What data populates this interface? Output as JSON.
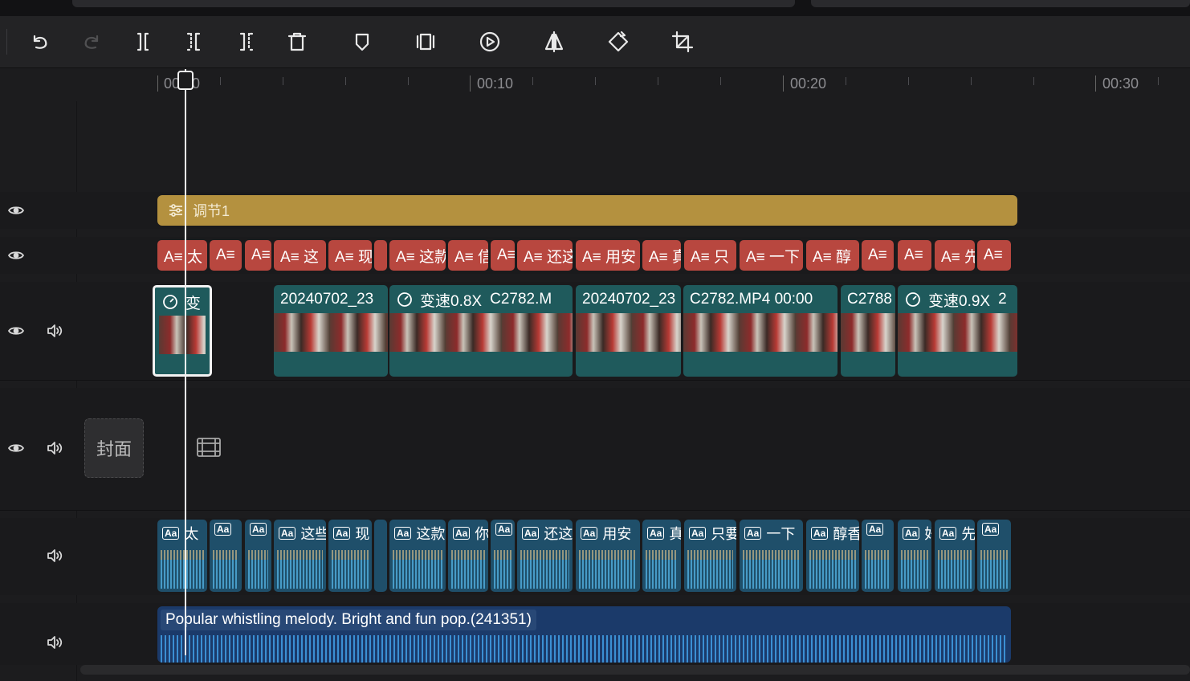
{
  "toolbar": {
    "buttons": [
      "undo",
      "redo",
      "split",
      "split-left",
      "split-right",
      "delete",
      "mark",
      "freeze",
      "play-segment",
      "mirror",
      "rotate",
      "crop"
    ]
  },
  "ruler": {
    "labels": [
      "00:00",
      "00:10",
      "00:20",
      "00:30"
    ]
  },
  "tracks": {
    "adjustment": {
      "label": "调节1",
      "color": "#b4913f"
    },
    "text_clips": [
      {
        "label": "A≡ 太"
      },
      {
        "label": "A≡"
      },
      {
        "label": "A≡"
      },
      {
        "label": "A≡ 这"
      },
      {
        "label": "A≡ 现"
      },
      {
        "label": ""
      },
      {
        "label": "A≡ 这款"
      },
      {
        "label": "A≡ 信"
      },
      {
        "label": "A≡"
      },
      {
        "label": "A≡ 还这"
      },
      {
        "label": "A≡ 用安"
      },
      {
        "label": "A≡ 真"
      },
      {
        "label": "A≡ 只"
      },
      {
        "label": "A≡ 一下"
      },
      {
        "label": "A≡ 醇"
      },
      {
        "label": "A≡"
      },
      {
        "label": "A≡"
      },
      {
        "label": "A≡ 先"
      },
      {
        "label": "A≡"
      }
    ],
    "video_clips": [
      {
        "speed": "变",
        "name": ""
      },
      {
        "speed": "",
        "name": "20240702_23"
      },
      {
        "speed": "变速0.8X",
        "name": "C2782.M"
      },
      {
        "speed": "",
        "name": "20240702_23"
      },
      {
        "speed": "",
        "name": "C2782.MP4 00:00"
      },
      {
        "speed": "",
        "name": "C2788"
      },
      {
        "speed": "变速0.9X",
        "name": "2"
      }
    ],
    "cover": {
      "label": "封面"
    },
    "voice_clips": [
      {
        "label": "太"
      },
      {
        "label": ""
      },
      {
        "label": ""
      },
      {
        "label": "这些"
      },
      {
        "label": "现"
      },
      {
        "label": ""
      },
      {
        "label": "这款"
      },
      {
        "label": "你"
      },
      {
        "label": ""
      },
      {
        "label": "还这"
      },
      {
        "label": "用安"
      },
      {
        "label": "真"
      },
      {
        "label": "只要"
      },
      {
        "label": "一下"
      },
      {
        "label": "醇香"
      },
      {
        "label": ""
      },
      {
        "label": "好"
      },
      {
        "label": "先"
      },
      {
        "label": ""
      }
    ],
    "music": {
      "label": "Popular whistling melody. Bright and fun pop.(241351)"
    }
  }
}
